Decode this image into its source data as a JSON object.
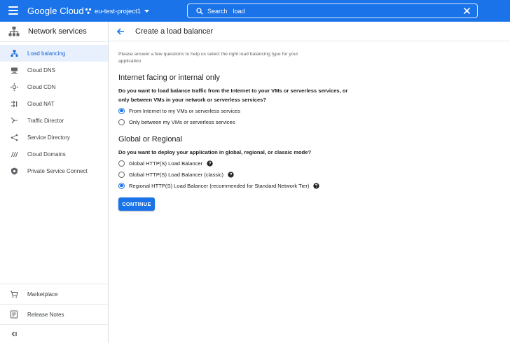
{
  "topbar": {
    "logo": "Google Cloud",
    "project": "eu-test-project1",
    "search_label": "Search",
    "search_value": "load"
  },
  "sidebar": {
    "title": "Network services",
    "items": [
      {
        "label": "Load balancing",
        "icon": "load-balancing-icon",
        "active": true
      },
      {
        "label": "Cloud DNS",
        "icon": "cloud-dns-icon"
      },
      {
        "label": "Cloud CDN",
        "icon": "cloud-cdn-icon"
      },
      {
        "label": "Cloud NAT",
        "icon": "cloud-nat-icon"
      },
      {
        "label": "Traffic Director",
        "icon": "traffic-director-icon"
      },
      {
        "label": "Service Directory",
        "icon": "service-directory-icon"
      },
      {
        "label": "Cloud Domains",
        "icon": "cloud-domains-icon"
      },
      {
        "label": "Private Service Connect",
        "icon": "private-service-connect-icon"
      }
    ],
    "bottom": {
      "marketplace": "Marketplace",
      "release_notes": "Release Notes"
    }
  },
  "main": {
    "title": "Create a load balancer",
    "intro": "Please answer a few questions to help us select the right load balancing type for your application",
    "section1": {
      "heading": "Internet facing or internal only",
      "question": "Do you want to load balance traffic from the Internet to your VMs or serverless services, or only between VMs in your network or serverless services?",
      "options": [
        {
          "label": "From Internet to my VMs or serverless services",
          "checked": true
        },
        {
          "label": "Only between my VMs or serverless services",
          "checked": false
        }
      ]
    },
    "section2": {
      "heading": "Global or Regional",
      "question": "Do you want to deploy your application in global, regional, or classic mode?",
      "options": [
        {
          "label": "Global HTTP(S) Load Balancer",
          "checked": false
        },
        {
          "label": "Global HTTP(S) Load Balancer (classic)",
          "checked": false
        },
        {
          "label": "Regional HTTP(S) Load Balancer (recommended for Standard Network Tier)",
          "checked": true
        }
      ]
    },
    "continue_label": "CONTINUE"
  },
  "colors": {
    "primary": "#1a73e8",
    "active_bg": "#e8f0fe"
  }
}
